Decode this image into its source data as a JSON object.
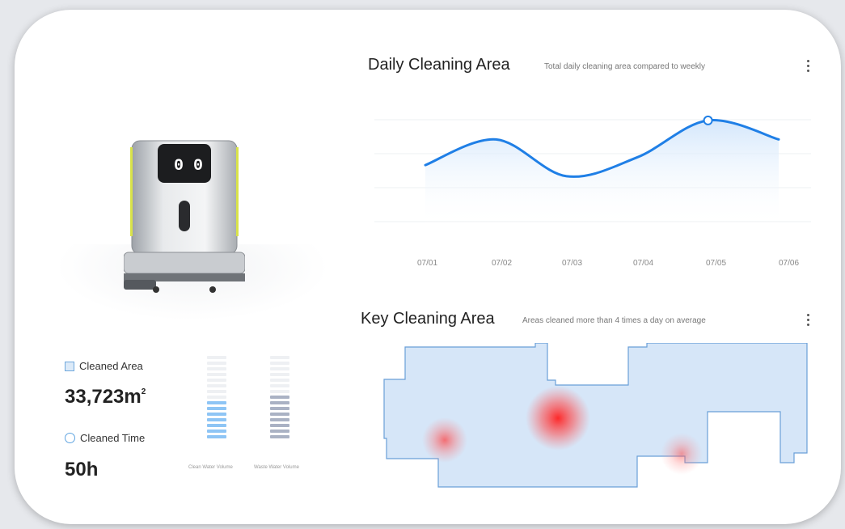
{
  "stats": {
    "area_label": "Cleaned Area",
    "area_value": "33,723m",
    "area_unit_sup": "2",
    "time_label": "Cleaned Time",
    "time_value": "50h"
  },
  "gauges": [
    {
      "label": "Clean Water Volume",
      "filled": 7,
      "total": 15,
      "color": "#8ec5f5"
    },
    {
      "label": "Waste Water Volume",
      "filled": 8,
      "total": 15,
      "color": "#aab2c4"
    }
  ],
  "daily": {
    "title": "Daily Cleaning Area",
    "subtitle": "Total daily cleaning area compared to weekly"
  },
  "key": {
    "title": "Key Cleaning Area",
    "subtitle": "Areas cleaned more than 4 times a day on average"
  },
  "chart_data": {
    "type": "line",
    "title": "Daily Cleaning Area",
    "categories": [
      "07/01",
      "07/02",
      "07/03",
      "07/04",
      "07/05",
      "07/06"
    ],
    "series": [
      {
        "values": [
          0.55,
          0.78,
          0.45,
          0.62,
          0.95,
          0.78
        ]
      }
    ],
    "highlight_index": 4,
    "line_color": "#1f7fe6",
    "grid": true
  },
  "heatspots": [
    {
      "label": "",
      "intensity": "high"
    },
    {
      "label": "",
      "intensity": "medium"
    },
    {
      "label": "",
      "intensity": "low"
    }
  ],
  "colors": {
    "accent": "#1f7fe6",
    "map_fill": "#d6e6f8",
    "map_stroke": "#6a9fd8",
    "heat": "#ff2b2b"
  }
}
